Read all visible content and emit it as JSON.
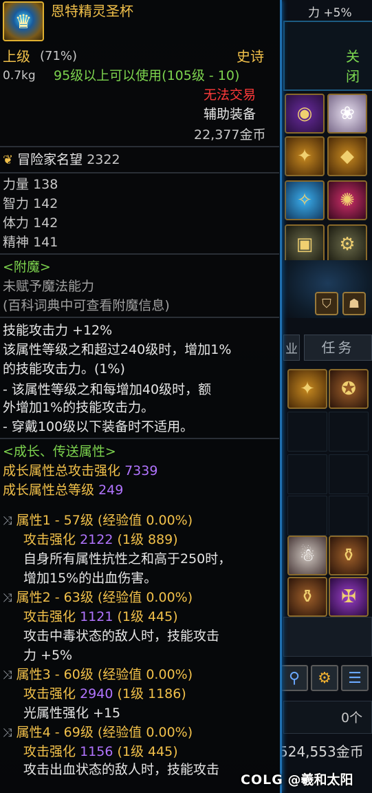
{
  "item": {
    "name": "恩特精灵圣杯",
    "grade": "上级",
    "grade_pct": "(71%)",
    "rarity": "史诗",
    "weight": "0.7kg",
    "level_req": "95级以上可以使用(105级 - 10)",
    "trade": "无法交易",
    "type": "辅助装备",
    "price": "22,377金币"
  },
  "adventurer": {
    "icon": "laurel-icon",
    "label": "冒险家名望",
    "value": "2322"
  },
  "stats": [
    {
      "label": "力量",
      "value": "138"
    },
    {
      "label": "智力",
      "value": "142"
    },
    {
      "label": "体力",
      "value": "142"
    },
    {
      "label": "精神",
      "value": "141"
    }
  ],
  "enchant": {
    "header": "<附魔>",
    "line1": "未赋予魔法能力",
    "line2": "(百科词典中可查看附魔信息)"
  },
  "skill": {
    "line1": "技能攻击力 +12%",
    "line2": "该属性等级之和超过240级时，增加1%",
    "line3": "的技能攻击力。(1%)",
    "line4": "- 该属性等级之和每增加40级时，额",
    "line5": "外增加1%的技能攻击力。",
    "line6": "- 穿戴100级以下装备时不适用。"
  },
  "growth": {
    "header": "<成长、传送属性>",
    "total_attack_label": "成长属性总攻击强化",
    "total_attack_value": "7339",
    "total_level_label": "成长属性总等级",
    "total_level_value": "249",
    "attrs": [
      {
        "title": "属性1 - 57级 (经验值 0.00%)",
        "attack_label": "攻击强化",
        "attack_value": "2122",
        "attack_detail": "(1级 889)",
        "desc1": "自身所有属性抗性之和高于250时，",
        "desc2": "增加15%的出血伤害。"
      },
      {
        "title": "属性2 - 63级 (经验值 0.00%)",
        "attack_label": "攻击强化",
        "attack_value": "1121",
        "attack_detail": "(1级 445)",
        "desc1": "攻击中毒状态的敌人时，技能攻击",
        "desc2": "力 +5%"
      },
      {
        "title": "属性3 - 60级 (经验值 0.00%)",
        "attack_label": "攻击强化",
        "attack_value": "2940",
        "attack_detail": "(1级 1186)",
        "desc1": "光属性强化 +15",
        "desc2": ""
      },
      {
        "title": "属性4 - 69级 (经验值 0.00%)",
        "attack_label": "攻击强化",
        "attack_value": "1156",
        "attack_detail": "(1级 445)",
        "desc1": "攻击出血状态的敌人时，技能攻击",
        "desc2": ""
      }
    ]
  },
  "background": {
    "stat_chip": "力 +5%",
    "close_label": "关闭",
    "tab_left": "业",
    "tab_mission": "任务",
    "count": "0个",
    "gold_total": "524,553金币",
    "watermark_brand": "COLG",
    "watermark_user": "@羲和太阳"
  },
  "colors": {
    "gold": "#f2c14a",
    "green": "#7dd44e",
    "red": "#ff3a3a",
    "purple": "#b174ff",
    "border_blue": "#1f6fb0"
  }
}
